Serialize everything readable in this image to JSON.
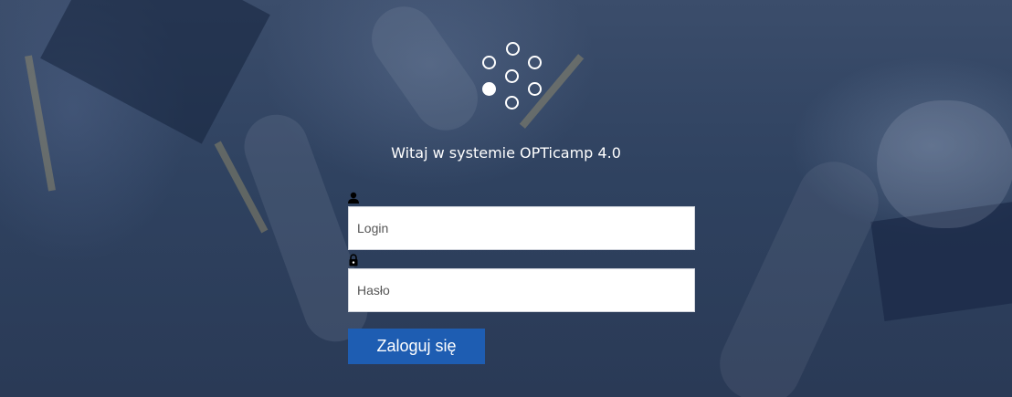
{
  "welcome_text": "Witaj w systemie OPTicamp 4.0",
  "login_field": {
    "icon": "user-icon",
    "placeholder": "Login",
    "value": ""
  },
  "password_field": {
    "icon": "lock-icon",
    "placeholder": "Hasło",
    "value": ""
  },
  "submit_label": "Zaloguj się",
  "colors": {
    "button": "#1e5db2",
    "background": "#30425f",
    "text": "#ffffff"
  }
}
